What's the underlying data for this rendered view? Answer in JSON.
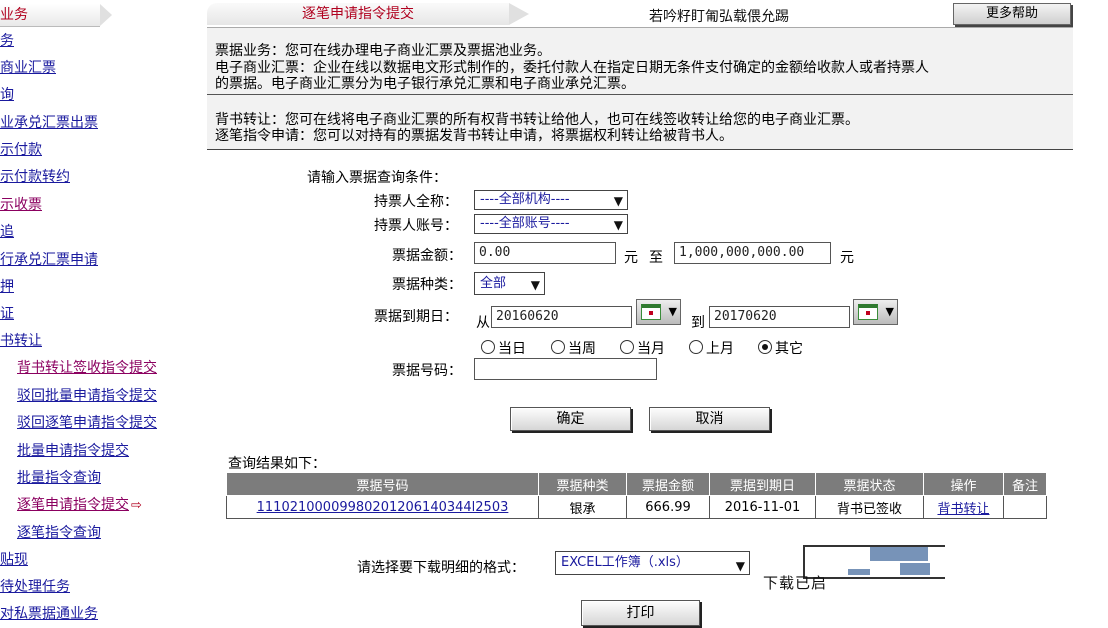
{
  "sidebar": {
    "header": "业务",
    "items": [
      {
        "label": "务"
      },
      {
        "label": "商业汇票"
      },
      {
        "label": "询"
      },
      {
        "label": "业承兑汇票出票"
      },
      {
        "label": "示付款"
      },
      {
        "label": "示付款转约"
      },
      {
        "label": "示收票"
      },
      {
        "label": "追"
      },
      {
        "label": "行承兑汇票申请"
      },
      {
        "label": "押"
      },
      {
        "label": "证"
      },
      {
        "label": "书转让"
      },
      {
        "label": "背书转让签收指令提交"
      },
      {
        "label": "驳回批量申请指令提交"
      },
      {
        "label": "驳回逐笔申请指令提交"
      },
      {
        "label": "批量申请指令提交"
      },
      {
        "label": "批量指令查询"
      },
      {
        "label": "逐笔申请指令提交"
      },
      {
        "label": "逐笔指令查询"
      },
      {
        "label": "贴现"
      },
      {
        "label": "待处理任务"
      },
      {
        "label": "对私票据通业务"
      }
    ]
  },
  "topbar": {
    "tab_title": "逐笔申请指令提交",
    "marquee": "若吟籽盯匍弘载偎允踢",
    "more_help": "更多帮助"
  },
  "info": {
    "line1": "票据业务：您可在线办理电子商业汇票及票据池业务。",
    "line2": "电子商业汇票：企业在线以数据电文形式制作的，委托付款人在指定日期无条件支付确定的金额给收款人或者持票人",
    "line3": "的票据。电子商业汇票分为电子银行承兑汇票和电子商业承兑汇票。",
    "line4": "背书转让：您可在线将电子商业汇票的所有权背书转让给他人，也可在线签收转让给您的电子商业汇票。",
    "line5": "逐笔指令申请：您可以对持有的票据发背书转让申请，将票据权利转让给被背书人。"
  },
  "form": {
    "section_title": "请输入票据查询条件：",
    "holder_name_label": "持票人全称：",
    "holder_name_value": "----全部机构----",
    "holder_account_label": "持票人账号：",
    "holder_account_value": "----全部账号----",
    "amount_label": "票据金额：",
    "amount_from": "0.00",
    "amount_unit1": "元",
    "amount_to_label": "至",
    "amount_to": "1,000,000,000.00",
    "amount_unit2": "元",
    "type_label": "票据种类：",
    "type_value": "全部",
    "due_label": "票据到期日：",
    "due_from_prefix": "从",
    "due_from": "20160620",
    "due_to_prefix": "到",
    "due_to": "20170620",
    "radios": [
      {
        "label": "当日",
        "checked": false
      },
      {
        "label": "当周",
        "checked": false
      },
      {
        "label": "当月",
        "checked": false
      },
      {
        "label": "上月",
        "checked": false
      },
      {
        "label": "其它",
        "checked": true
      }
    ],
    "bill_no_label": "票据号码：",
    "bill_no_value": "",
    "confirm": "确定",
    "cancel": "取消"
  },
  "results": {
    "title": "查询结果如下：",
    "columns": [
      "票据号码",
      "票据种类",
      "票据金额",
      "票据到期日",
      "票据状态",
      "操作",
      "备注"
    ],
    "rows": [
      {
        "bill_no": "11102100009980201206140344l2503",
        "type": "银承",
        "amount": "666.99",
        "due_date": "2016-11-01",
        "status": "背书已签收",
        "action": "背书转让",
        "remark": ""
      }
    ]
  },
  "footer": {
    "export_label": "请选择要下载明细的格式：",
    "export_value": "EXCEL工作簿（.xls）",
    "overlay_text": "下载已启",
    "print": "打印"
  },
  "colors": {
    "accent_red": "#b0001e",
    "link_blue": "#1a1a9e",
    "active_purple": "#8b0060",
    "table_header": "#7c7c7c",
    "panel_bg": "#f2f2f2"
  }
}
